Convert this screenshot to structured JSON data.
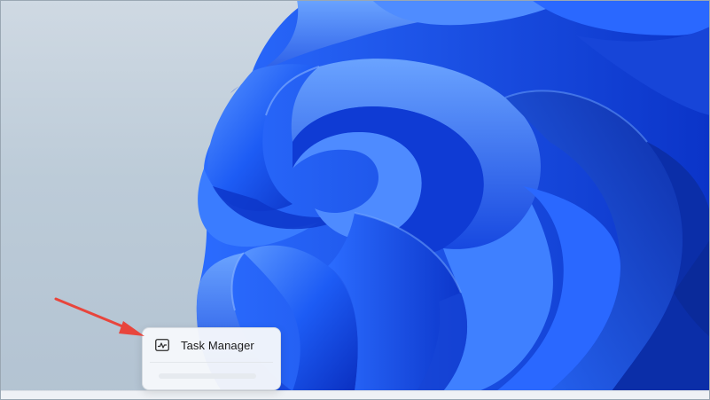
{
  "desktop": {
    "wallpaper": "windows-11-bloom-wallpaper",
    "colors": {
      "background": "#c4d1dd",
      "bloom_dark": "#0a2fbd",
      "bloom_mid": "#1b5cf2",
      "bloom_light": "#4f8cff"
    }
  },
  "context_menu": {
    "items": [
      {
        "label": "Task Manager",
        "icon": "task-manager-icon"
      }
    ]
  },
  "annotation": {
    "arrow_color": "#e8453c"
  }
}
